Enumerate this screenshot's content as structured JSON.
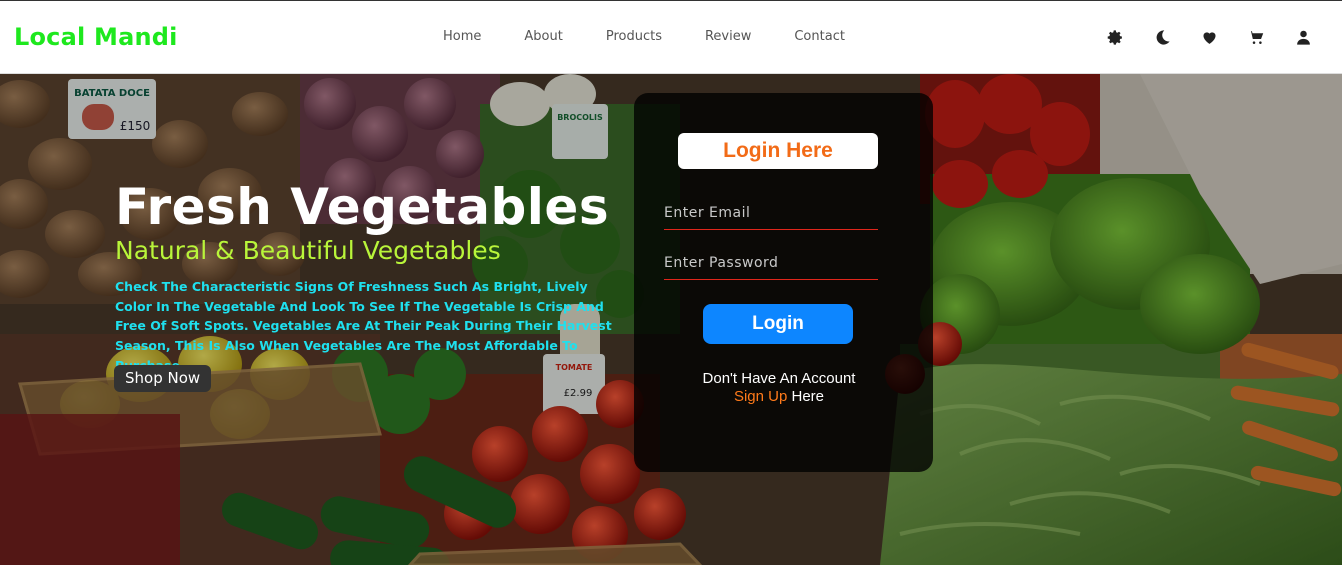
{
  "header": {
    "brand": "Local Mandi",
    "nav": [
      "Home",
      "About",
      "Products",
      "Review",
      "Contact"
    ],
    "icons": [
      "settings-icon",
      "moon-icon",
      "heart-icon",
      "cart-icon",
      "user-icon"
    ]
  },
  "hero": {
    "title": "Fresh Vegetables",
    "subtitle": "Natural & Beautiful Vegetables",
    "description": "Check The Characteristic Signs Of Freshness Such As Bright, Lively Color In The Vegetable And Look To See If The Vegetable Is Crisp And Free Of Soft Spots. Vegetables Are At Their Peak During Their Harvest Season, This Is Also When Vegetables Are The Most Affordable To Purchase..",
    "shop_button": "Shop Now",
    "price_tags": [
      "BATATA DOCE",
      "£150",
      "BROCOLIS",
      "TOMATE",
      "£2.99"
    ]
  },
  "login": {
    "title": "Login Here",
    "email_placeholder": "Enter Email",
    "password_placeholder": "Enter Password",
    "button": "Login",
    "no_account": "Don't Have An Account",
    "signup_link": "Sign Up",
    "signup_suffix": " Here"
  },
  "colors": {
    "brand": "#1ee81e",
    "subtitle": "#b9f53a",
    "description": "#1fe0ee",
    "login_title": "#f26b17",
    "login_button": "#0d86ff",
    "field_underline": "#e0261b",
    "signup_link": "#ff7a1a"
  }
}
